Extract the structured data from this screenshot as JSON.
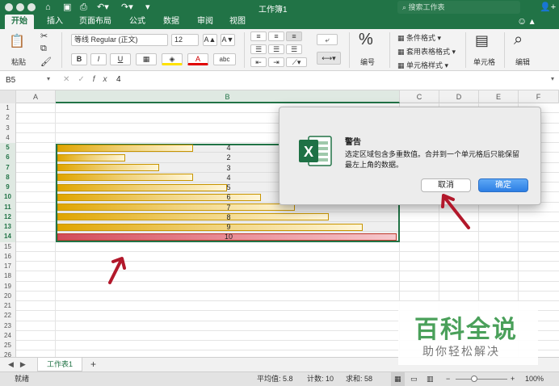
{
  "window": {
    "title": "工作簿1",
    "search_placeholder": "搜索工作表"
  },
  "ribbon_tabs": [
    "开始",
    "插入",
    "页面布局",
    "公式",
    "数据",
    "审阅",
    "视图"
  ],
  "ribbon": {
    "paste": "粘贴",
    "font_name": "等线 Regular (正文)",
    "font_size": "12",
    "bold": "B",
    "italic": "I",
    "underline": "U",
    "number_format": "编号",
    "conditional_format": "条件格式",
    "table_format": "套用表格格式",
    "cell_styles": "单元格样式",
    "cells": "单元格",
    "editing": "编辑"
  },
  "formula": {
    "name_box": "B5",
    "value": "4"
  },
  "columns": [
    "A",
    "B",
    "C",
    "D",
    "E",
    "F"
  ],
  "rows": [
    "1",
    "2",
    "3",
    "4",
    "5",
    "6",
    "7",
    "8",
    "9",
    "10",
    "11",
    "12",
    "13",
    "14",
    "15",
    "16",
    "17",
    "18",
    "19",
    "20",
    "21",
    "22",
    "23",
    "24",
    "25",
    "26"
  ],
  "cells": {
    "values": [
      "4",
      "2",
      "3",
      "4",
      "5",
      "6",
      "7",
      "8",
      "9",
      "10"
    ],
    "max": 10,
    "bar_color": "#e0a500",
    "highlight_color": "#d24c5a"
  },
  "dialog": {
    "title": "警告",
    "message": "选定区域包含多重数值。合并到一个单元格后只能保留最左上角的数据。",
    "cancel": "取消",
    "ok": "确定"
  },
  "sheets": {
    "active": "工作表1"
  },
  "status": {
    "ready": "就绪",
    "average": "平均值: 5.8",
    "count": "计数: 10",
    "sum": "求和: 58",
    "zoom": "100%"
  },
  "watermark": {
    "line1": "百科全说",
    "line2": "助你轻松解决"
  }
}
